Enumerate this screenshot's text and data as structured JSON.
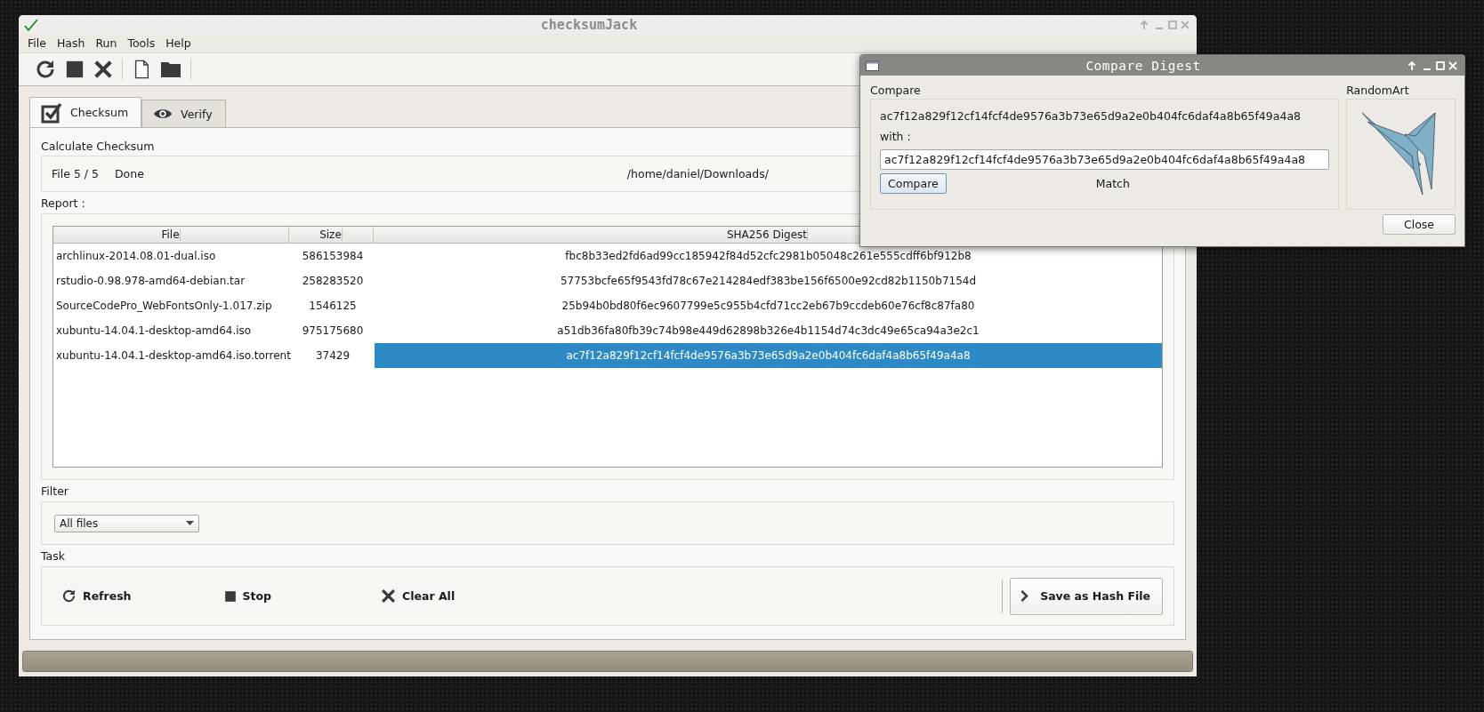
{
  "main_window": {
    "title": "checksumJack",
    "menu": [
      "File",
      "Hash",
      "Run",
      "Tools",
      "Help"
    ],
    "tabs": [
      {
        "label": "Checksum",
        "kind": "check",
        "selected": true
      },
      {
        "label": "Verify",
        "kind": "eye",
        "selected": false
      }
    ],
    "calculate": {
      "heading": "Calculate Checksum",
      "file_count": "File 5 / 5",
      "status": "Done",
      "path": "/home/daniel/Downloads/"
    },
    "report": {
      "heading": "Report :",
      "columns": [
        "File",
        "Size",
        "SHA256 Digest"
      ],
      "rows": [
        {
          "file": "archlinux-2014.08.01-dual.iso",
          "size": "586153984",
          "digest": "fbc8b33ed2fd6ad99cc185942f84d52cfc2981b05048c261e555cdff6bf912b8",
          "selected": false
        },
        {
          "file": "rstudio-0.98.978-amd64-debian.tar",
          "size": "258283520",
          "digest": "57753bcfe65f9543fd78c67e214284edf383be156f6500e92cd82b1150b7154d",
          "selected": false
        },
        {
          "file": "SourceCodePro_WebFontsOnly-1.017.zip",
          "size": "1546125",
          "digest": "25b94b0bd80f6ec9607799e5c955b4cfd71cc2eb67b9ccdeb60e76cf8c87fa80",
          "selected": false
        },
        {
          "file": "xubuntu-14.04.1-desktop-amd64.iso",
          "size": "975175680",
          "digest": "a51db36fa80fb39c74b98e449d62898b326e4b1154d74c3dc49e65ca94a3e2c1",
          "selected": false
        },
        {
          "file": "xubuntu-14.04.1-desktop-amd64.iso.torrent",
          "size": "37429",
          "digest": "ac7f12a829f12cf14fcf4de9576a3b73e65d9a2e0b404fc6daf4a8b65f49a4a8",
          "selected": true
        }
      ]
    },
    "filter": {
      "heading": "Filter",
      "value": "All files"
    },
    "task": {
      "heading": "Task",
      "buttons": [
        {
          "label": "Refresh",
          "kind": "refresh"
        },
        {
          "label": "Stop",
          "kind": "stop"
        },
        {
          "label": "Clear All",
          "kind": "clear"
        }
      ],
      "save_button": "Save as Hash File"
    },
    "progress": {
      "level": 1
    }
  },
  "dialog": {
    "title": "Compare Digest",
    "heading": "Compare",
    "digest": "ac7f12a829f12cf14fcf4de9576a3b73e65d9a2e0b404fc6daf4a8b65f49a4a8",
    "with_label": "with :",
    "input_value": "ac7f12a829f12cf14fcf4de9576a3b73e65d9a2e0b404fc6daf4a8b65f49a4a8",
    "compare_button": "Compare",
    "result": "Match",
    "art_heading": "RandomArt",
    "close_button": "Close"
  }
}
